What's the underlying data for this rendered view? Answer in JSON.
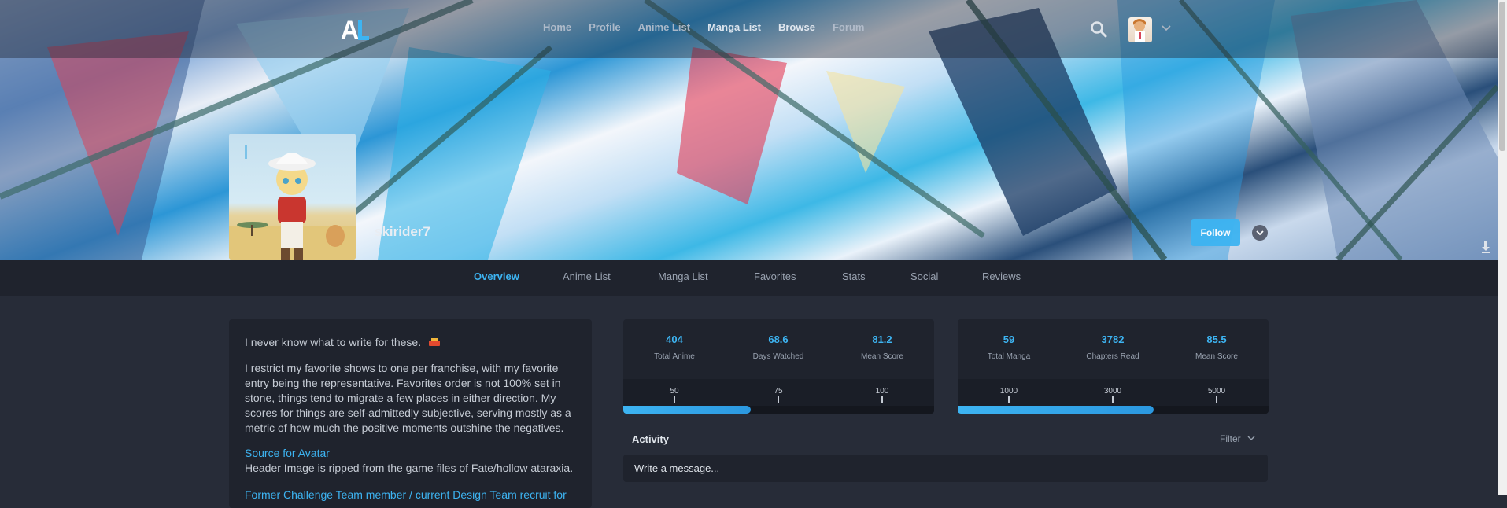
{
  "nav": {
    "logo_text": "AL",
    "items": [
      "Home",
      "Profile",
      "Anime List",
      "Manga List",
      "Browse",
      "Forum"
    ],
    "active_item": "Manga List"
  },
  "profile": {
    "username": "skirider7",
    "follow_label": "Follow"
  },
  "tabs": [
    "Overview",
    "Anime List",
    "Manga List",
    "Favorites",
    "Stats",
    "Social",
    "Reviews"
  ],
  "active_tab": "Overview",
  "bio": {
    "line1": "I never know what to write for these.",
    "paragraph": "I restrict my favorite shows to one per franchise, with my favorite entry being the representative. Favorites order is not 100% set in stone, things tend to migrate a few places in either direction. My scores for things are self-admittedly subjective, serving mostly as a metric of how much the positive moments outshine the negatives.",
    "avatar_link": "Source for Avatar",
    "header_note": "Header Image is ripped from the game files of Fate/hollow ataraxia.",
    "team_line": "Former Challenge Team member / current Design Team recruit for"
  },
  "anime_stats": {
    "stats": [
      {
        "value": "404",
        "label": "Total Anime"
      },
      {
        "value": "68.6",
        "label": "Days Watched"
      },
      {
        "value": "81.2",
        "label": "Mean Score"
      }
    ],
    "ticks": [
      "50",
      "75",
      "100"
    ],
    "progress_fraction": 0.41
  },
  "manga_stats": {
    "stats": [
      {
        "value": "59",
        "label": "Total Manga"
      },
      {
        "value": "3782",
        "label": "Chapters Read"
      },
      {
        "value": "85.5",
        "label": "Mean Score"
      }
    ],
    "ticks": [
      "1000",
      "3000",
      "5000"
    ],
    "progress_fraction": 0.63
  },
  "activity": {
    "title": "Activity",
    "filter_label": "Filter",
    "message_placeholder": "Write a message..."
  },
  "colors": {
    "accent": "#3db4f2",
    "panel": "#1f232d",
    "background": "#272c38"
  }
}
